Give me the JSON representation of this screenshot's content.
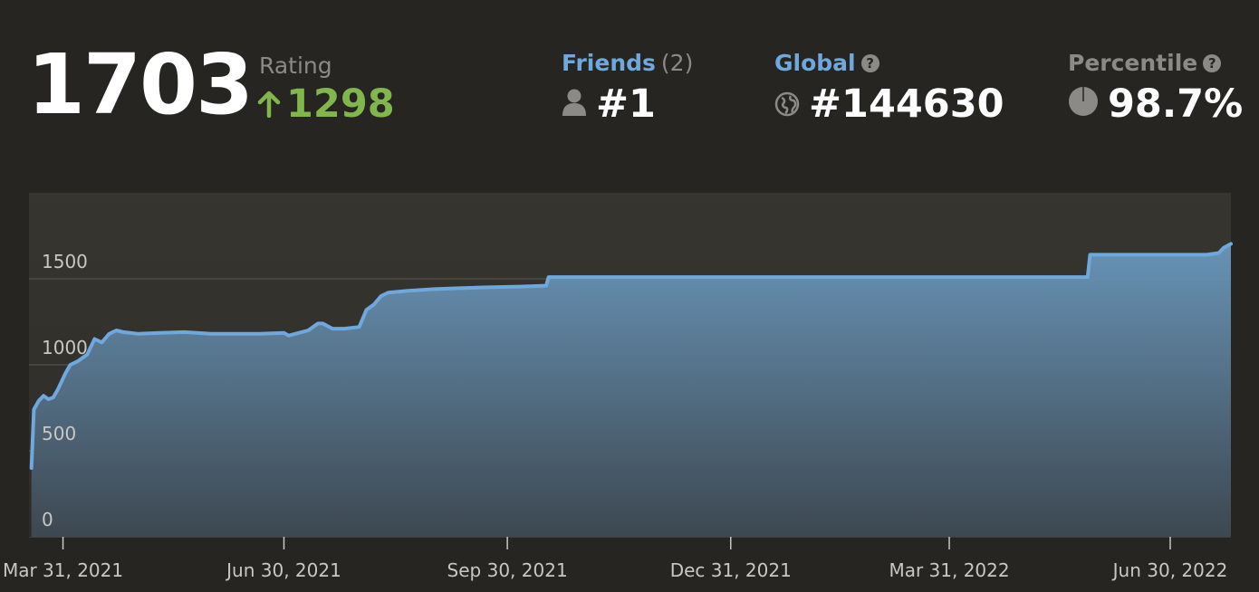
{
  "header": {
    "rating": "1703",
    "rating_label": "Rating",
    "rating_change": "1298",
    "friends": {
      "label": "Friends",
      "count": "(2)",
      "rank": "#1"
    },
    "global": {
      "label": "Global",
      "help": "?",
      "rank": "#144630"
    },
    "percentile": {
      "label": "Percentile",
      "help": "?",
      "value": "98.7%"
    }
  },
  "colors": {
    "background": "#262522",
    "accent_blue": "#6fa8dc",
    "line": "#6fa8dc",
    "positive_green": "#81b64c",
    "muted": "#8c8a87"
  },
  "chart_data": {
    "type": "area",
    "title": "",
    "xlabel": "",
    "ylabel": "",
    "ylim": [
      0,
      2000
    ],
    "yticks": [
      0,
      500,
      1000,
      1500
    ],
    "ytick_labels": [
      "0",
      "500",
      "1000",
      "1500"
    ],
    "xlim": [
      "2021-03-17",
      "2022-07-25"
    ],
    "xticks": [
      "2021-03-31",
      "2021-06-30",
      "2021-09-30",
      "2021-12-31",
      "2022-03-31",
      "2022-06-30"
    ],
    "xtick_labels": [
      "Mar 31, 2021",
      "Jun 30, 2021",
      "Sep 30, 2021",
      "Dec 31, 2021",
      "Mar 31, 2022",
      "Jun 30, 2022"
    ],
    "grid": true,
    "series": [
      {
        "x": [
          "2021-03-18",
          "2021-03-19",
          "2021-03-21",
          "2021-03-23",
          "2021-03-25",
          "2021-03-27",
          "2021-03-29",
          "2021-04-01",
          "2021-04-03",
          "2021-04-06",
          "2021-04-08",
          "2021-04-10",
          "2021-04-13",
          "2021-04-16",
          "2021-04-19",
          "2021-04-22",
          "2021-04-25",
          "2021-04-28",
          "2021-05-01",
          "2021-05-10",
          "2021-05-20",
          "2021-05-31",
          "2021-06-10",
          "2021-06-20",
          "2021-06-30",
          "2021-07-02",
          "2021-07-06",
          "2021-07-10",
          "2021-07-14",
          "2021-07-16",
          "2021-07-20",
          "2021-07-25",
          "2021-07-31",
          "2021-08-03",
          "2021-08-06",
          "2021-08-09",
          "2021-08-12",
          "2021-08-20",
          "2021-08-31",
          "2021-09-10",
          "2021-09-20",
          "2021-10-05",
          "2021-10-16",
          "2021-10-17",
          "2021-11-15",
          "2021-12-31",
          "2022-02-15",
          "2022-04-15",
          "2022-05-27",
          "2022-05-28",
          "2022-06-15",
          "2022-06-30",
          "2022-07-15",
          "2022-07-20",
          "2022-07-22",
          "2022-07-25"
        ],
        "y": [
          400,
          740,
          790,
          820,
          800,
          810,
          860,
          950,
          1000,
          1020,
          1040,
          1060,
          1150,
          1130,
          1180,
          1200,
          1190,
          1185,
          1180,
          1185,
          1190,
          1180,
          1180,
          1180,
          1185,
          1170,
          1185,
          1200,
          1240,
          1240,
          1210,
          1210,
          1220,
          1320,
          1350,
          1400,
          1420,
          1430,
          1440,
          1445,
          1450,
          1455,
          1460,
          1510,
          1510,
          1510,
          1510,
          1510,
          1510,
          1640,
          1640,
          1640,
          1640,
          1650,
          1680,
          1703
        ]
      }
    ]
  }
}
